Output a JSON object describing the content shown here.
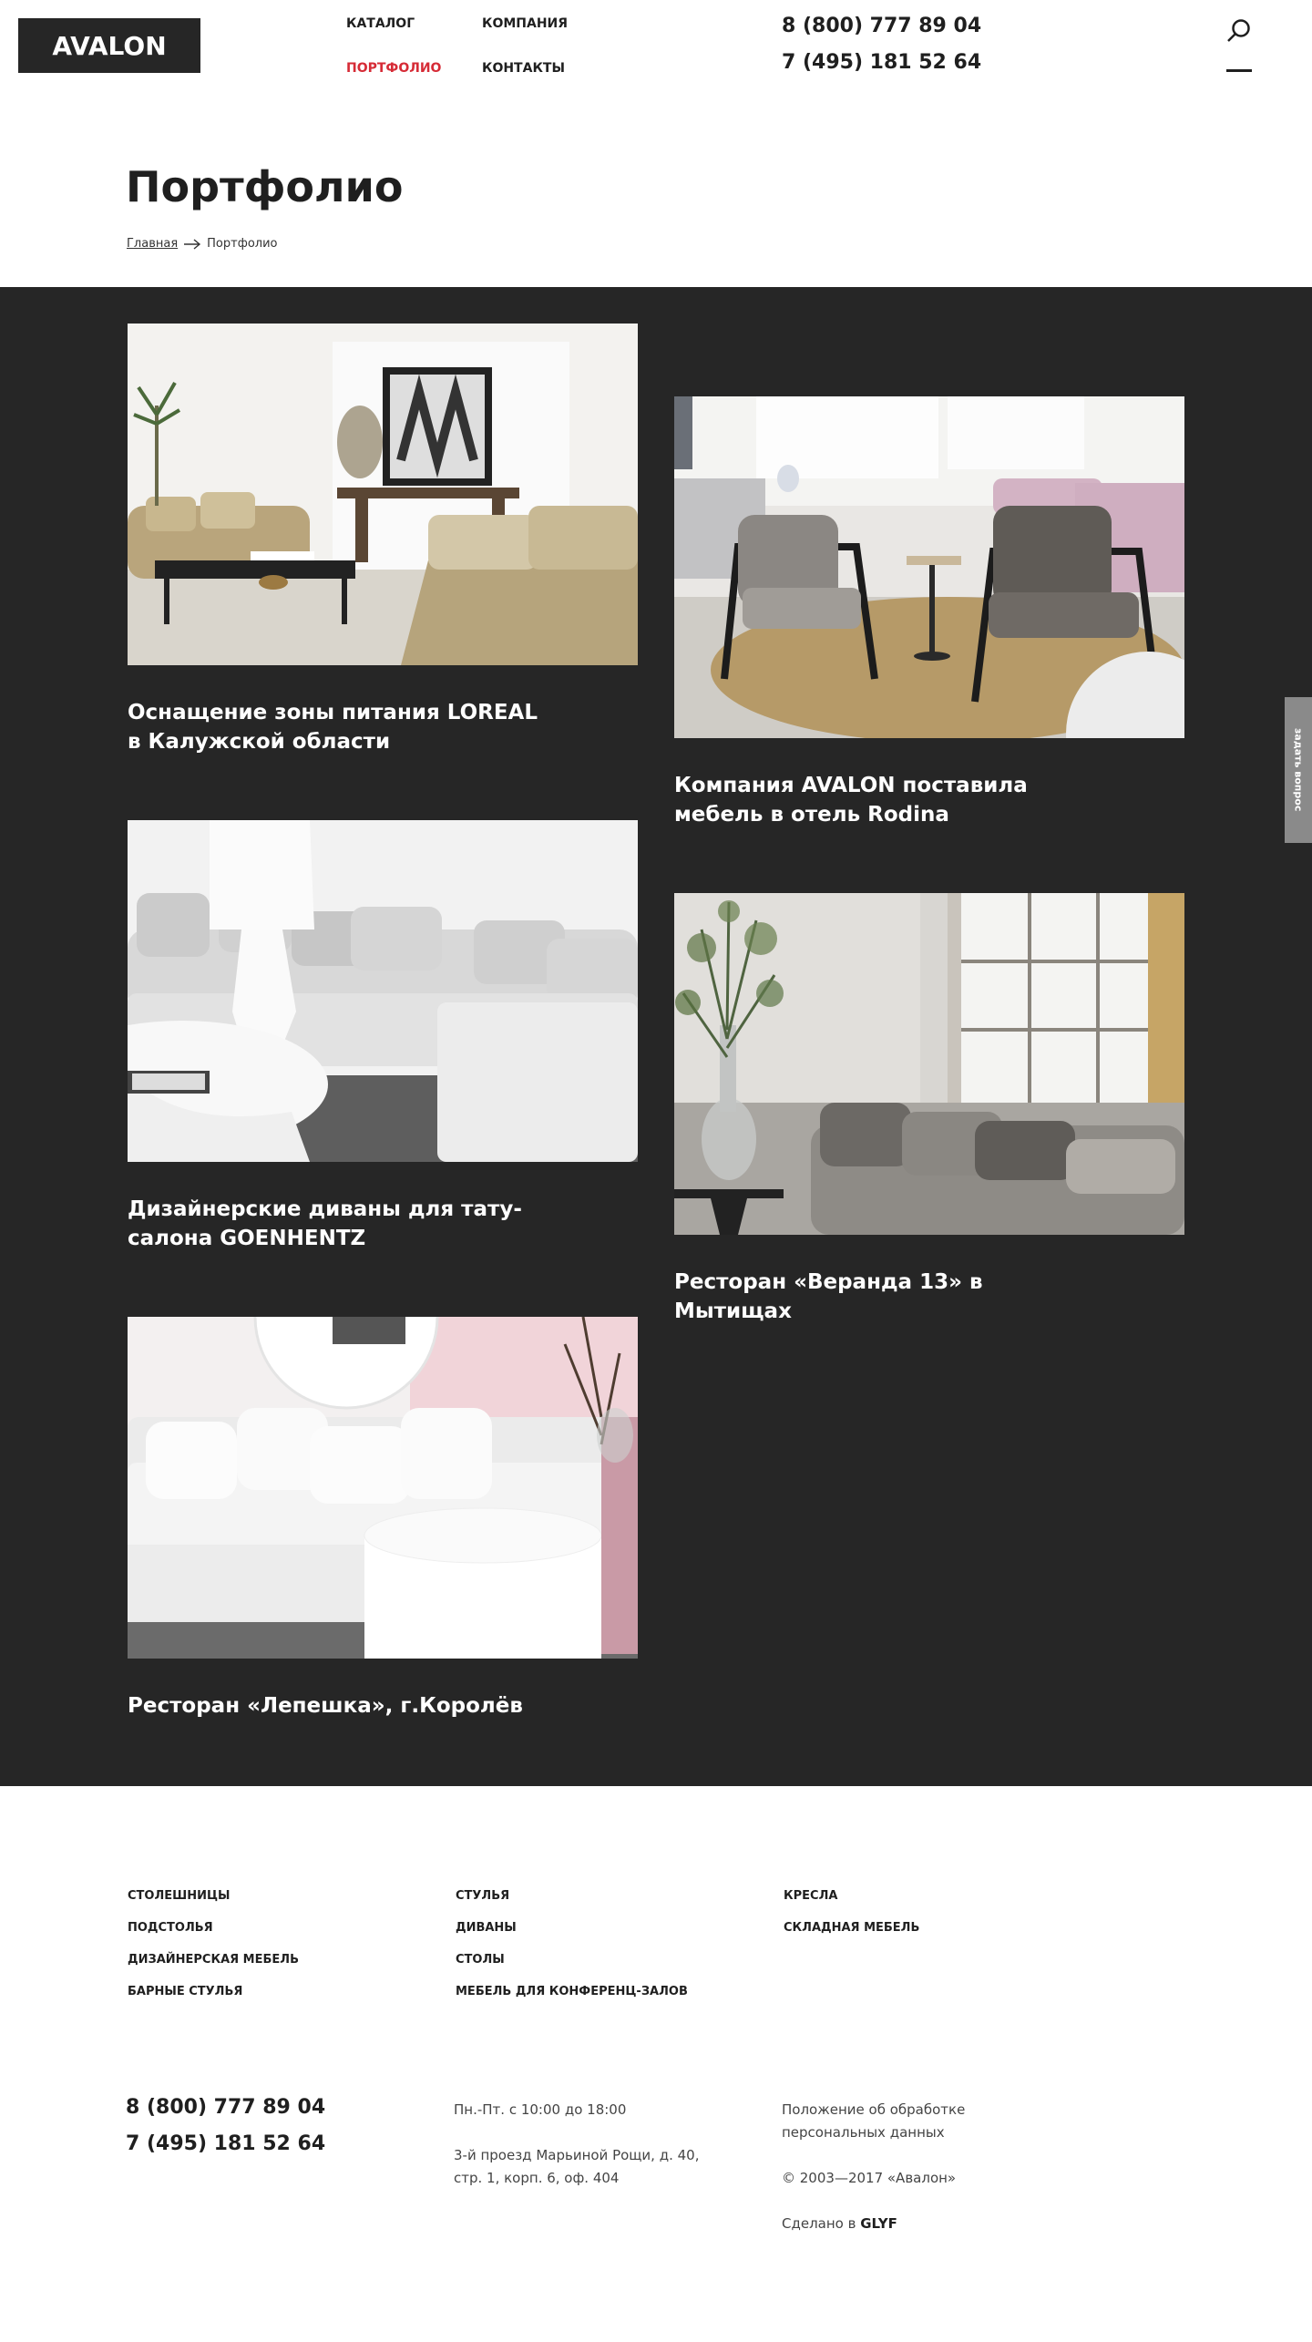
{
  "header": {
    "logo": "AVALON",
    "nav": [
      {
        "label": "Каталог"
      },
      {
        "label": "Компания"
      },
      {
        "label": "Портфолио",
        "active": true
      },
      {
        "label": "Контакты"
      }
    ],
    "phones": [
      "8 (800) 777 89 04",
      "7 (495) 181 52 64"
    ],
    "search_icon": "search-icon",
    "menu_icon": "hamburger-icon"
  },
  "page": {
    "title": "Портфолио",
    "breadcrumb": {
      "home": "Главная",
      "current": "Портфолио"
    }
  },
  "portfolio": {
    "items": [
      {
        "caption": "Оснащение зоны питания LOREAL в Калужской области"
      },
      {
        "caption": "Компания AVALON поставила мебель в отель Rodina"
      },
      {
        "caption": "Дизайнерские диваны для тату-салона GOENHENTZ"
      },
      {
        "caption": "Ресторан «Веранда 13» в Мытищах"
      },
      {
        "caption": "Ресторан «Лепешка», г.Королёв"
      }
    ]
  },
  "ask_tab": "задать вопрос",
  "footer": {
    "categories": [
      [
        "Столешницы",
        "Подстолья",
        "Дизайнерская мебель",
        "Барные стулья"
      ],
      [
        "Стулья",
        "Диваны",
        "Столы",
        "Мебель для конференц-залов"
      ],
      [
        "Кресла",
        "Складная мебель"
      ]
    ],
    "phones": [
      "8 (800) 777 89 04",
      "7 (495) 181 52 64"
    ],
    "hours": "Пн.-Пт. с 10:00 до 18:00",
    "address_line1": "3-й проезд Марьиной Рощи, д. 40,",
    "address_line2": "стр. 1, корп. 6, оф. 404",
    "privacy_line1": "Положение об обработке",
    "privacy_line2": "персональных данных",
    "copyright": "© 2003—2017 «Авалон»",
    "made_by_prefix": "Сделано в",
    "made_by_brand": "GLYF"
  },
  "colors": {
    "accent": "#d62b36",
    "dark": "#262626"
  }
}
